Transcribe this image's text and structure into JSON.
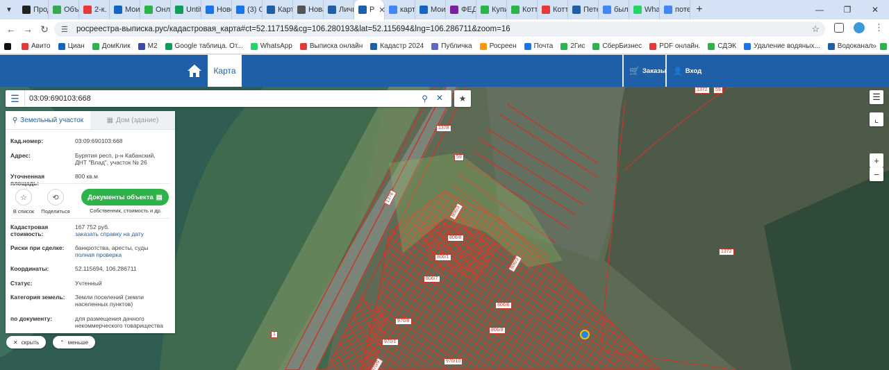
{
  "browser": {
    "tabs": [
      {
        "label": "Прод",
        "color": "#222222"
      },
      {
        "label": "Объя",
        "color": "#34a853"
      },
      {
        "label": "2-к. к",
        "color": "#e53935"
      },
      {
        "label": "Мои",
        "color": "#1565c0"
      },
      {
        "label": "Онла",
        "color": "#2db34a"
      },
      {
        "label": "Untit",
        "color": "#0f9d58"
      },
      {
        "label": "Ново",
        "color": "#1a73e8"
      },
      {
        "label": "(3) О",
        "color": "#1a73e8"
      },
      {
        "label": "Карт",
        "color": "#1f5fa8"
      },
      {
        "label": "Нова",
        "color": "#555555"
      },
      {
        "label": "Личн",
        "color": "#1f5fa8"
      },
      {
        "label": "Р",
        "color": "#1f5fa8",
        "active": true
      },
      {
        "label": "карте",
        "color": "#4285f4"
      },
      {
        "label": "Мои",
        "color": "#1565c0"
      },
      {
        "label": "ФЕДЕ",
        "color": "#7b1fa2"
      },
      {
        "label": "Купи",
        "color": "#2db34a"
      },
      {
        "label": "Котт",
        "color": "#2db34a"
      },
      {
        "label": "Котт",
        "color": "#e53935"
      },
      {
        "label": "Пете",
        "color": "#1f5fa8"
      },
      {
        "label": "было",
        "color": "#4285f4"
      },
      {
        "label": "What",
        "color": "#25d366"
      },
      {
        "label": "поте",
        "color": "#4285f4"
      }
    ],
    "url": "росреестра-выписка.рус/кадастровая_карта#ct=52.117159&cg=106.280193&lat=52.115694&lng=106.286711&zoom=16",
    "bookmarks": [
      {
        "label": "Авито",
        "color": "#e53935"
      },
      {
        "label": "Циан",
        "color": "#1565c0"
      },
      {
        "label": "ДомКлик",
        "color": "#2db34a"
      },
      {
        "label": "M2",
        "color": "#3949ab"
      },
      {
        "label": "Google таблица. От...",
        "color": "#0f9d58"
      },
      {
        "label": "WhatsApp",
        "color": "#25d366"
      },
      {
        "label": "Выписка онлайн",
        "color": "#e53935"
      },
      {
        "label": "Кадастр 2024",
        "color": "#1f5fa8"
      },
      {
        "label": "Публичка",
        "color": "#5c6bc0"
      },
      {
        "label": "Росреен",
        "color": "#ff9800"
      },
      {
        "label": "Почта",
        "color": "#1a73e8"
      },
      {
        "label": "2Гис",
        "color": "#2db34a"
      },
      {
        "label": "СберБизнес",
        "color": "#2db34a"
      },
      {
        "label": "PDF онлайн.",
        "color": "#e53935"
      },
      {
        "label": "СДЭК",
        "color": "#2db34a"
      },
      {
        "label": "Удаление водяных...",
        "color": "#1a73e8"
      },
      {
        "label": "Водоканал",
        "color": "#1f5fa8"
      },
      {
        "label": "ЭкоАльянс",
        "color": "#2db34a"
      },
      {
        "label": "мфц",
        "color": "#e53935"
      }
    ]
  },
  "header": {
    "nav_map": "Карта",
    "orders": "Заказы",
    "login": "Вход"
  },
  "search": {
    "value": "03:09:690103:668"
  },
  "panel": {
    "tab_land": "Земельный участок",
    "tab_house": "Дом (здание)",
    "cad_num_label": "Кад.номер:",
    "cad_num_value": "03:09:690103:668",
    "address_label": "Адрес:",
    "address_value": "Бурятия респ, р-н Кабанский, ДНТ \"Влад\", участок № 26",
    "area_label": "Уточненная площадь:",
    "area_value": "800 кв.м",
    "to_list": "В список",
    "share": "Поделиться",
    "docs_button": "Документы объекта",
    "docs_sub": "Собственник, стоимость и др.",
    "cost_label": "Кадастровая стоимость:",
    "cost_value": "167 752 руб.",
    "cost_link": "заказать справку на дату",
    "risks_label": "Риски при сделке:",
    "risks_value": "банкротства, аресты, суды",
    "risks_link": "полная проверка",
    "coords_label": "Координаты:",
    "coords_value": "52.115694, 106.286711",
    "status_label": "Статус:",
    "status_value": "Учтенный",
    "category_label": "Категория земель:",
    "category_value": "Земли поселений (земли населенных пунктов)",
    "doc_label": "по документу:",
    "doc_value": "для размещения дачного некоммерческого товарищества"
  },
  "bottom": {
    "hide": "скрыть",
    "less": "меньше"
  },
  "map_labels": [
    "1372",
    "59",
    "1378",
    "59",
    "1378",
    "1372",
    "806/3",
    "806/8",
    "806/1",
    "806/7",
    "806/3",
    "806/6",
    "806/9",
    "970/8",
    "970/1",
    "970/10",
    "970/9",
    "1"
  ],
  "colors": {
    "header": "#1f5fa8",
    "accent_green": "#2db34a",
    "parcel_red": "#c0392b"
  }
}
